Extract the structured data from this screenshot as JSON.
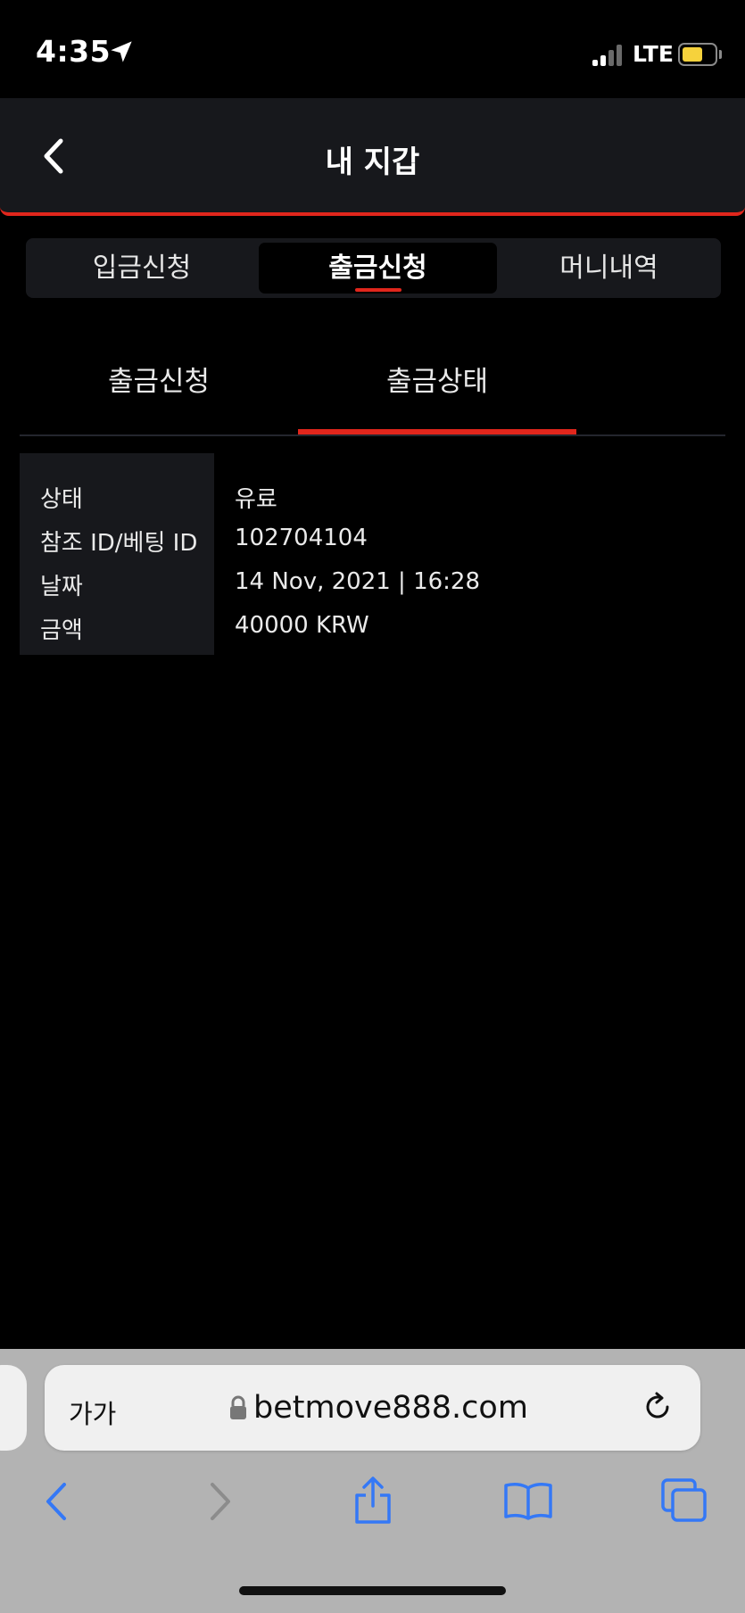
{
  "status_bar": {
    "time": "4:35",
    "network": "LTE"
  },
  "header": {
    "title": "내 지갑"
  },
  "top_tabs": [
    {
      "label": "입금신청",
      "active": false
    },
    {
      "label": "출금신청",
      "active": true
    },
    {
      "label": "머니내역",
      "active": false
    }
  ],
  "sub_tabs": [
    {
      "label": "출금신청",
      "active": false
    },
    {
      "label": "출금상태",
      "active": true
    }
  ],
  "details": [
    {
      "label": "상태",
      "value": "유료"
    },
    {
      "label": "참조 ID/베팅 ID",
      "value": "102704104"
    },
    {
      "label": "날짜",
      "value": "14 Nov, 2021 | 16:28"
    },
    {
      "label": "금액",
      "value": "40000 KRW"
    }
  ],
  "browser": {
    "text_size_label": "가가",
    "url": "betmove888.com"
  },
  "colors": {
    "accent": "#e1261c",
    "panel": "#17181c",
    "safari_link": "#3478f6"
  }
}
